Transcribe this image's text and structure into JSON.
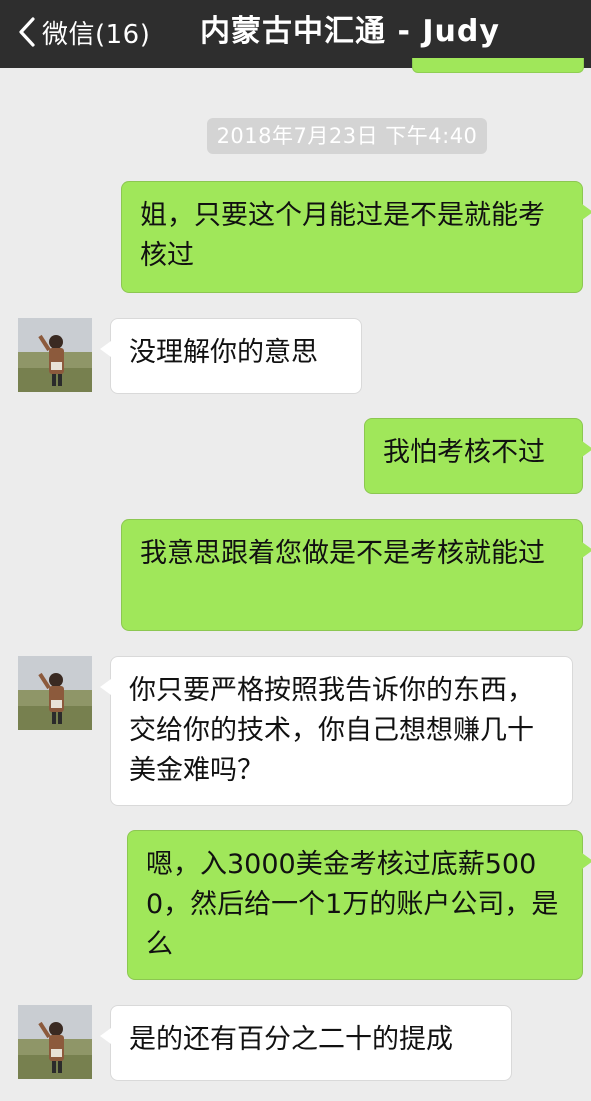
{
  "navbar": {
    "back_label": "微信(16)",
    "title": "内蒙古中汇通 - Judy"
  },
  "timestamp": "2018年7月23日 下午4:40",
  "colors": {
    "navbar_bg": "#2e2e2e",
    "chat_bg": "#ececec",
    "sent_bubble": "#a0e75a",
    "received_bubble": "#ffffff"
  },
  "icons": [
    "back-chevron-icon",
    "contact-avatar"
  ],
  "messages": [
    {
      "sender": "me",
      "text": "姐，只要这个月能过是不是就能考核过"
    },
    {
      "sender": "them",
      "text": "没理解你的意思"
    },
    {
      "sender": "me",
      "text": "我怕考核不过"
    },
    {
      "sender": "me",
      "text": "我意思跟着您做是不是考核就能过"
    },
    {
      "sender": "them",
      "text": "你只要严格按照我告诉你的东西，交给你的技术，你自己想想赚几十美金难吗？"
    },
    {
      "sender": "me",
      "text": "嗯，入3000美金考核过底薪5000，然后给一个1万的账户公司，是么"
    },
    {
      "sender": "them",
      "text": "是的还有百分之二十的提成"
    }
  ]
}
